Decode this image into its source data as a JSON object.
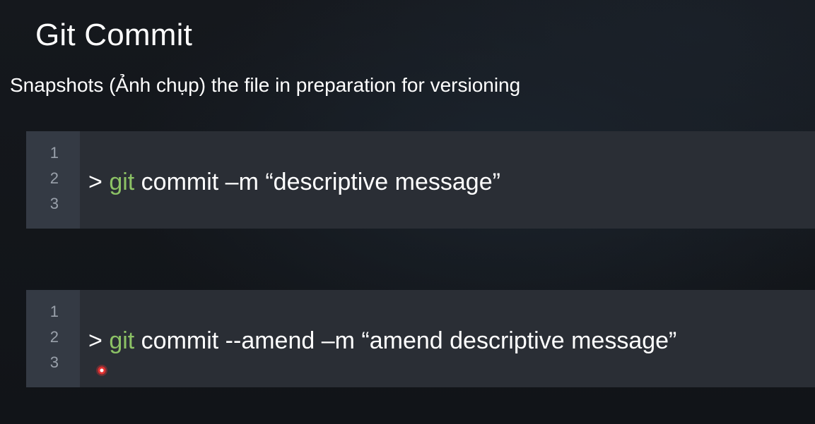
{
  "slide": {
    "title": "Git Commit",
    "subtitle": "Snapshots (Ảnh chụp) the file in preparation for versioning"
  },
  "code_blocks": [
    {
      "line_numbers": [
        "1",
        "2",
        "3"
      ],
      "prompt": ">",
      "command": "git",
      "rest": " commit –m “descriptive message”"
    },
    {
      "line_numbers": [
        "1",
        "2",
        "3"
      ],
      "prompt": ">",
      "command": "git",
      "rest": " commit --amend –m “amend descriptive message”"
    }
  ],
  "colors": {
    "background": "#121519",
    "code_background": "#2a2e35",
    "gutter_background": "#343a44",
    "command_green": "#8cc265",
    "text": "#ffffff",
    "line_number": "#9aa1ab",
    "cursor_red": "#e03030"
  },
  "icons": {
    "cursor": "mouse-pointer-highlight-icon"
  }
}
